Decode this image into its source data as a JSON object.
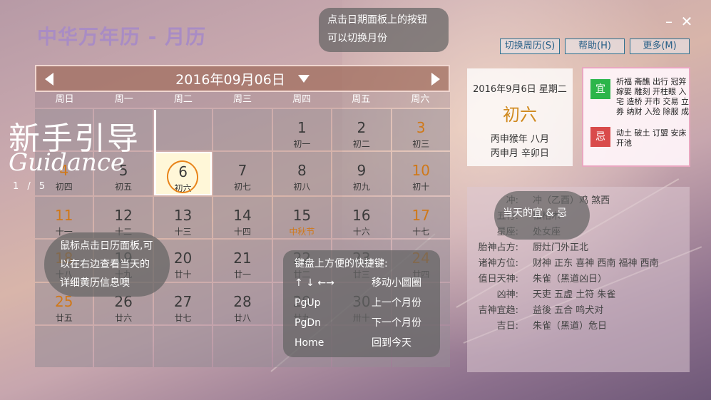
{
  "app": {
    "title": "中华万年历 - 月历"
  },
  "window": {
    "minimize": "–",
    "close": "✕"
  },
  "toolbar": {
    "switch": "切换周历(S)",
    "help": "帮助(H)",
    "more": "更多(M)"
  },
  "calendar": {
    "title": "2016年09月06日",
    "weekdays": [
      "周日",
      "周一",
      "周二",
      "周三",
      "周四",
      "周五",
      "周六"
    ],
    "rows": [
      [
        {
          "d": "",
          "l": ""
        },
        {
          "d": "",
          "l": ""
        },
        {
          "d": "",
          "l": ""
        },
        {
          "d": "",
          "l": ""
        },
        {
          "d": "1",
          "l": "初一"
        },
        {
          "d": "2",
          "l": "初二"
        },
        {
          "d": "3",
          "l": "初三"
        }
      ],
      [
        {
          "d": "4",
          "l": "初四"
        },
        {
          "d": "5",
          "l": "初五"
        },
        {
          "d": "6",
          "l": "初六"
        },
        {
          "d": "7",
          "l": "初七"
        },
        {
          "d": "8",
          "l": "初八"
        },
        {
          "d": "9",
          "l": "初九"
        },
        {
          "d": "10",
          "l": "初十"
        }
      ],
      [
        {
          "d": "11",
          "l": "十一"
        },
        {
          "d": "12",
          "l": "十二"
        },
        {
          "d": "13",
          "l": "十三"
        },
        {
          "d": "14",
          "l": "十四"
        },
        {
          "d": "15",
          "l": "中秋节"
        },
        {
          "d": "16",
          "l": "十六"
        },
        {
          "d": "17",
          "l": "十七"
        }
      ],
      [
        {
          "d": "18",
          "l": "十八"
        },
        {
          "d": "19",
          "l": "十九"
        },
        {
          "d": "20",
          "l": "廿十"
        },
        {
          "d": "21",
          "l": "廿一"
        },
        {
          "d": "22",
          "l": "廿二"
        },
        {
          "d": "23",
          "l": "廿三"
        },
        {
          "d": "24",
          "l": "廿四"
        }
      ],
      [
        {
          "d": "25",
          "l": "廿五"
        },
        {
          "d": "26",
          "l": "廿六"
        },
        {
          "d": "27",
          "l": "廿七"
        },
        {
          "d": "28",
          "l": "廿八"
        },
        {
          "d": "29",
          "l": "廿九"
        },
        {
          "d": "30",
          "l": "卅十"
        },
        {
          "d": "",
          "l": ""
        }
      ],
      [
        {
          "d": "",
          "l": ""
        },
        {
          "d": "",
          "l": ""
        },
        {
          "d": "",
          "l": ""
        },
        {
          "d": "",
          "l": ""
        },
        {
          "d": "",
          "l": ""
        },
        {
          "d": "",
          "l": ""
        },
        {
          "d": "",
          "l": ""
        }
      ]
    ]
  },
  "info": {
    "date": "2016年9月6日 星期二",
    "lunar": "初六",
    "ganzhi1": "丙申猴年 八月",
    "ganzhi2": "丙申月 辛卯日"
  },
  "yiji": {
    "yi_label": "宜",
    "yi": "祈福 斋醮 出行 冠笄 嫁娶 雕刻 开柱眼 入宅 造桥 开市 交易 立券 纳财 入殓 除服 成",
    "ji_label": "忌",
    "ji": "动土 破土 订盟 安床 开池"
  },
  "details": [
    {
      "k": "冲:",
      "v": "冲（乙酉）鸡  煞西"
    },
    {
      "k": "五行:",
      "v": "松柏木"
    },
    {
      "k": "星座:",
      "v": "处女座"
    },
    {
      "k": "胎神占方:",
      "v": "厨灶门外正北"
    },
    {
      "k": "诸神方位:",
      "v": "财神 正东    喜神 西南    福神 西南"
    },
    {
      "k": "值日天神:",
      "v": "朱雀（黑道凶日）"
    },
    {
      "k": "凶神:",
      "v": "天吏 五虚 土符 朱雀"
    },
    {
      "k": "吉神宜趋:",
      "v": "益後 五合 鸣犬对"
    },
    {
      "k": "吉日:",
      "v": "朱雀（黑道）危日"
    }
  ],
  "tips": {
    "top": "点击日期面板上的按钮 可以切换月份",
    "left": "鼠标点击日历面板,可以在右边查看当天的详细黄历信息噢",
    "right": "当天的宜 & 忌",
    "keys_title": "键盘上方便的快捷键:",
    "keys": [
      {
        "k": "↑ ↓ ←→",
        "v": "移动小圆圈"
      },
      {
        "k": "PgUp",
        "v": "上一个月份"
      },
      {
        "k": "PgDn",
        "v": "下一个月份"
      },
      {
        "k": "Home",
        "v": "回到今天"
      }
    ]
  },
  "guide": {
    "title": "新手引导",
    "subtitle": "Guidance",
    "step": "1 / 5"
  }
}
